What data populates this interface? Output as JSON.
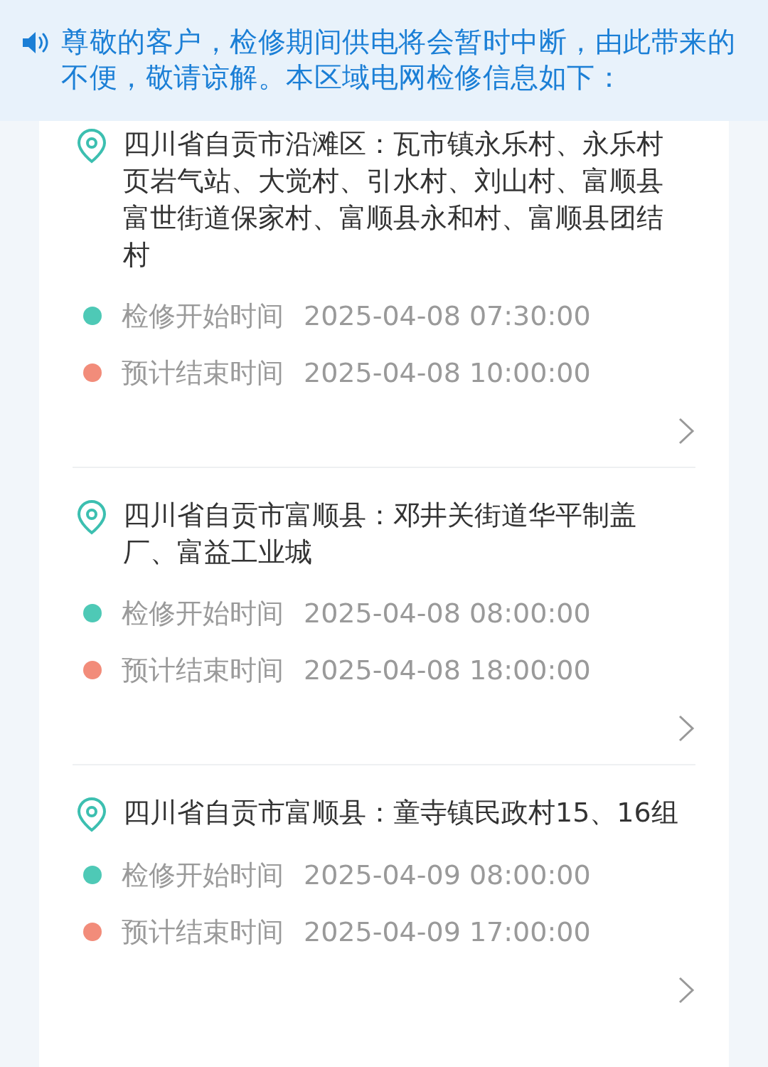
{
  "notice": {
    "text": "尊敬的客户，检修期间供电将会暂时中断，由此带来的不便，敬请谅解。本区域电网检修信息如下："
  },
  "outages": [
    {
      "area": "四川省自贡市沿滩区：瓦市镇永乐村、永乐村页岩气站、大觉村、引水村、刘山村、富顺县富世街道保家村、富顺县永和村、富顺县团结村",
      "times": [
        {
          "label": "检修开始时间",
          "time": "2025-04-08 07:30:00",
          "color": "#4ec9b6"
        },
        {
          "label": "预计结束时间",
          "time": "2025-04-08 10:00:00",
          "color": "#f28c7a"
        }
      ]
    },
    {
      "area": "四川省自贡市富顺县：邓井关街道华平制盖厂、富益工业城",
      "times": [
        {
          "label": "检修开始时间",
          "time": "2025-04-08 08:00:00",
          "color": "#4ec9b6"
        },
        {
          "label": "预计结束时间",
          "time": "2025-04-08 18:00:00",
          "color": "#f28c7a"
        }
      ]
    },
    {
      "area": "四川省自贡市富顺县：童寺镇民政村15、16组",
      "times": [
        {
          "label": "检修开始时间",
          "time": "2025-04-09 08:00:00",
          "color": "#4ec9b6"
        },
        {
          "label": "预计结束时间",
          "time": "2025-04-09 17:00:00",
          "color": "#f28c7a"
        }
      ]
    }
  ]
}
